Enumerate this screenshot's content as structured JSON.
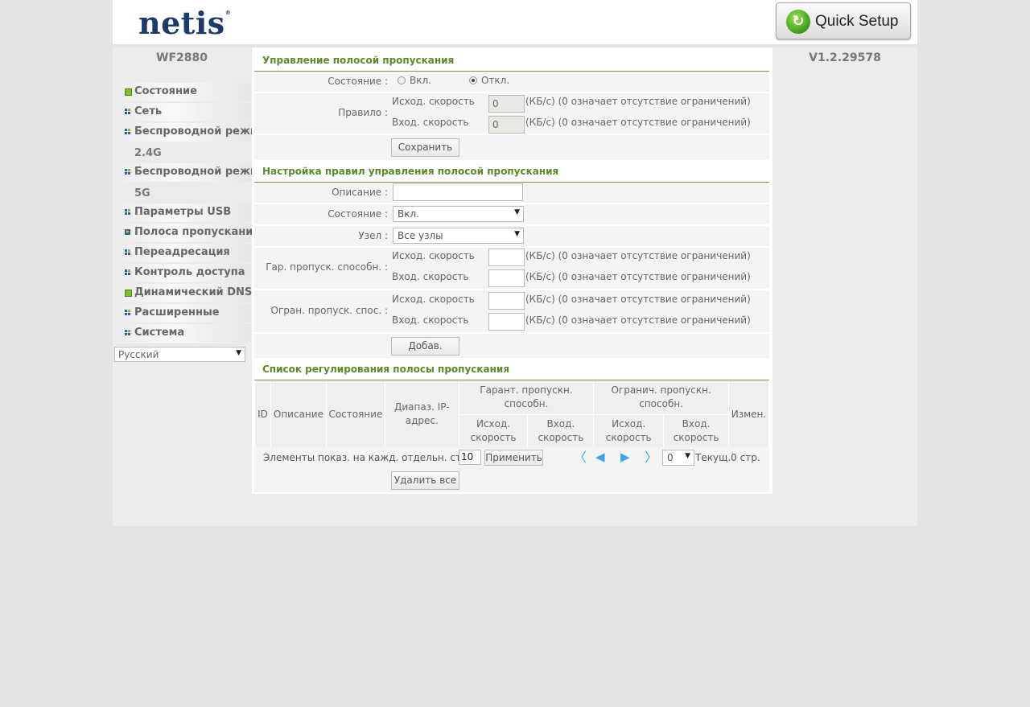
{
  "header": {
    "logo": "netis",
    "logo_mark": "®",
    "quick_setup": "Quick Setup"
  },
  "sidebar": {
    "model": "WF2880",
    "items": [
      {
        "label": "Состояние",
        "icon": "green-square-icon"
      },
      {
        "label": "Сеть",
        "icon": "grid-icon"
      },
      {
        "label": "Беспроводной режим",
        "icon": "grid-icon",
        "sub": "2.4G"
      },
      {
        "label": "Беспроводной режим",
        "icon": "grid-icon",
        "sub": "5G"
      },
      {
        "label": "Параметры USB",
        "icon": "grid-icon"
      },
      {
        "label": "Полоса пропускания",
        "icon": "arrow-right-icon"
      },
      {
        "label": "Переадресация",
        "icon": "grid-icon"
      },
      {
        "label": "Контроль доступа",
        "icon": "grid-icon"
      },
      {
        "label": "Динамический DNS",
        "icon": "green-square-icon"
      },
      {
        "label": "Расширенные",
        "icon": "grid-icon"
      },
      {
        "label": "Система",
        "icon": "grid-icon"
      }
    ],
    "language": "Русский"
  },
  "version": "V1.2.29578",
  "bandwidth_control": {
    "title": "Управление полосой пропускания",
    "state_label": "Состояние :",
    "on_label": "Вкл.",
    "off_label": "Откл.",
    "selected": "off",
    "rule_label": "Правило :",
    "up_label": "Исход. скорость",
    "down_label": "Вход. скорость",
    "up_value": "0",
    "down_value": "0",
    "unit_note": "(КБ/с) (0 означает отсутствие ограничений)",
    "save_button": "Сохранить"
  },
  "rule_settings": {
    "title": "Настройка правил управления полосой пропускания",
    "desc_label": "Описание :",
    "desc_value": "",
    "state_label": "Состояние :",
    "state_value": "Вкл.",
    "node_label": "Узел :",
    "node_value": "Все узлы",
    "guaranteed_label": "Гар. пропуск. способн. :",
    "limit_label": "Огран. пропуск. спос. :",
    "up_label": "Исход. скорость",
    "down_label": "Вход. скорость",
    "unit_note": "(КБ/с) (0 означает отсутствие ограничений)",
    "add_button": "Добав."
  },
  "rule_list": {
    "title": "Список регулирования полосы пропускания",
    "columns": {
      "id": "ID",
      "desc": "Описание",
      "state": "Состояние",
      "ip_range": "Диапаз. IP-адрес.",
      "guaranteed": "Гарант. пропускн. способн.",
      "limit": "Огранич. пропускн. способн.",
      "up": "Исход. скорость",
      "down": "Вход. скорость",
      "edit": "Измен."
    },
    "per_page_label": "Элементы показ. на кажд. отдельн. стр.",
    "per_page_value": "10",
    "apply_button": "Применить",
    "page_value": "0",
    "current_page": "Текущ.0 стр.",
    "delete_all_button": "Удалить все"
  }
}
